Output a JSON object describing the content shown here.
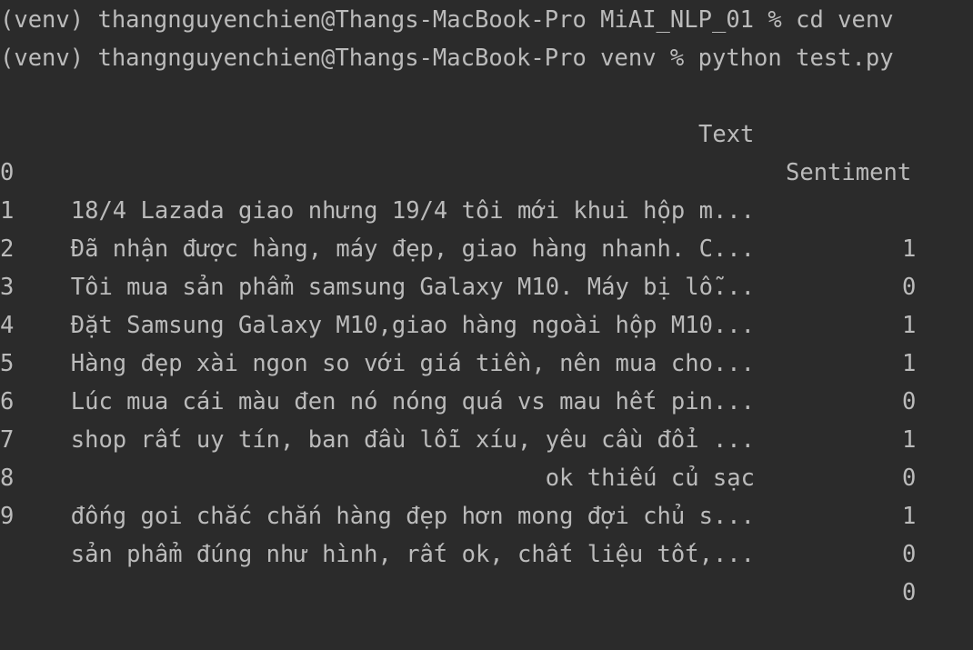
{
  "terminal": {
    "commands": [
      {
        "prompt": "(venv) thangnguyenchien@Thangs-MacBook-Pro MiAI_NLP_01 % ",
        "command": "cd venv"
      },
      {
        "prompt": "(venv) thangnguyenchien@Thangs-MacBook-Pro venv % ",
        "command": "python test.py"
      }
    ],
    "table": {
      "columns": [
        "Text",
        "Sentiment"
      ],
      "rows": [
        {
          "index": "0",
          "text": "18/4 Lazada giao nhưng 19/4 tôi mới khui hộp m...",
          "sentiment": "1"
        },
        {
          "index": "1",
          "text": "Đã nhận được hàng, máy đẹp, giao hàng nhanh. C...",
          "sentiment": "0"
        },
        {
          "index": "2",
          "text": "Tôi mua sản phẩm samsung Galaxy M10. Máy bị lỗ...",
          "sentiment": "1"
        },
        {
          "index": "3",
          "text": "Đặt Samsung Galaxy M10,giao hàng ngoài hộp M10...",
          "sentiment": "1"
        },
        {
          "index": "4",
          "text": "Hàng đẹp xài ngon so với giá tiền, nên mua cho...",
          "sentiment": "0"
        },
        {
          "index": "5",
          "text": "Lúc mua cái màu đen nó nóng quá vs mau hết pin...",
          "sentiment": "1"
        },
        {
          "index": "6",
          "text": "shop rất uy tín, ban đầu lỗi xíu, yêu cầu đổi ...",
          "sentiment": "0"
        },
        {
          "index": "7",
          "text": "ok thiếu củ sạc",
          "sentiment": "1"
        },
        {
          "index": "8",
          "text": "đống goi chắc chắn hàng đẹp hơn mong đợi chủ s...",
          "sentiment": "0"
        },
        {
          "index": "9",
          "text": "sản phẩm đúng như hình, rất ok, chất liệu tốt,...",
          "sentiment": "0"
        }
      ]
    }
  }
}
